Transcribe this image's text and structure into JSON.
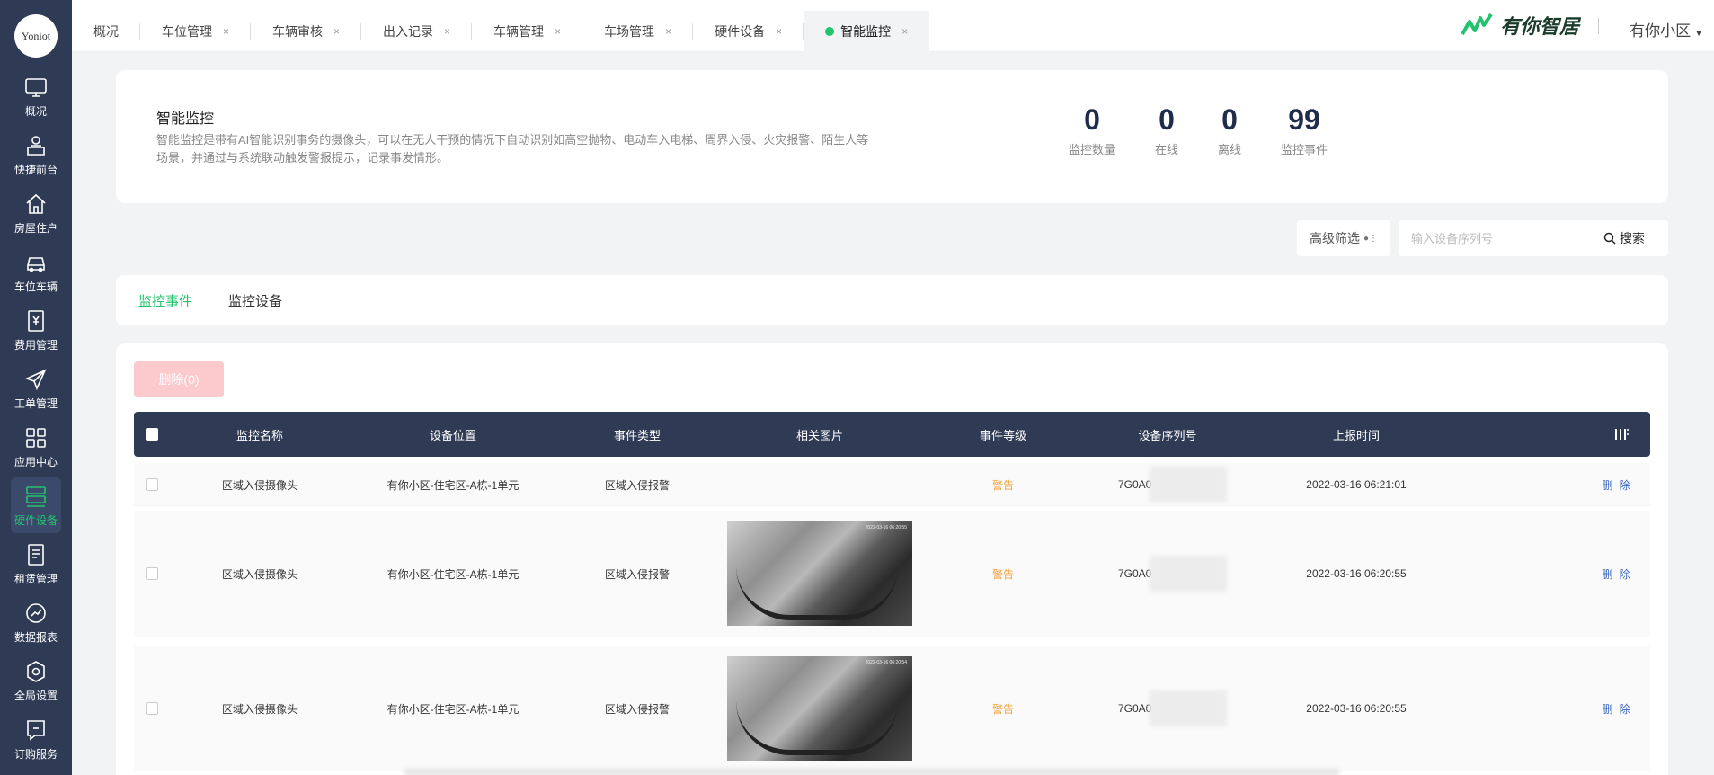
{
  "logo": {
    "text": "Yoniot"
  },
  "sidebar": {
    "items": [
      {
        "label": "概况",
        "icon": "monitor-icon"
      },
      {
        "label": "快捷前台",
        "icon": "desk-icon"
      },
      {
        "label": "房屋住户",
        "icon": "house-icon"
      },
      {
        "label": "车位车辆",
        "icon": "car-icon"
      },
      {
        "label": "费用管理",
        "icon": "fee-icon"
      },
      {
        "label": "工单管理",
        "icon": "send-icon"
      },
      {
        "label": "应用中心",
        "icon": "grid-icon"
      },
      {
        "label": "硬件设备",
        "icon": "server-icon",
        "active": true
      },
      {
        "label": "租赁管理",
        "icon": "document-icon"
      },
      {
        "label": "数据报表",
        "icon": "chart-icon"
      },
      {
        "label": "全局设置",
        "icon": "settings-icon"
      },
      {
        "label": "订购服务",
        "icon": "order-icon"
      }
    ]
  },
  "tabs": [
    {
      "label": "概况",
      "closable": false
    },
    {
      "label": "车位管理",
      "closable": true
    },
    {
      "label": "车辆审核",
      "closable": true
    },
    {
      "label": "出入记录",
      "closable": true
    },
    {
      "label": "车辆管理",
      "closable": true
    },
    {
      "label": "车场管理",
      "closable": true
    },
    {
      "label": "硬件设备",
      "closable": true
    },
    {
      "label": "智能监控",
      "closable": true,
      "active": true
    }
  ],
  "tab_close_glyph": "×",
  "brand": {
    "name": "有你智居"
  },
  "community": {
    "name": "有你小区"
  },
  "info": {
    "title": "智能监控",
    "description": "智能监控是带有AI智能识别事务的摄像头，可以在无人干预的情况下自动识别如高空抛物、电动车入电梯、周界入侵、火灾报警、陌生人等场景，并通过与系统联动触发警报提示，记录事发情形。",
    "stats": [
      {
        "value": "0",
        "label": "监控数量"
      },
      {
        "value": "0",
        "label": "在线"
      },
      {
        "value": "0",
        "label": "离线"
      },
      {
        "value": "99",
        "label": "监控事件"
      }
    ]
  },
  "filter": {
    "label": "高级筛选"
  },
  "search": {
    "placeholder": "输入设备序列号",
    "value": "",
    "button": "搜索"
  },
  "subtabs": [
    {
      "label": "监控事件",
      "active": true
    },
    {
      "label": "监控设备",
      "active": false
    }
  ],
  "table": {
    "delete_button": "删除(0)",
    "headers": [
      "监控名称",
      "设备位置",
      "事件类型",
      "相关图片",
      "事件等级",
      "设备序列号",
      "上报时间"
    ],
    "rows": [
      {
        "name": "区域入侵摄像头",
        "location": "有你小区-住宅区-A栋-1单元",
        "type": "区域入侵报警",
        "has_image": false,
        "level": "警告",
        "serial": "7G0A0",
        "time": "2022-03-16 06:21:01",
        "action": "删 除"
      },
      {
        "name": "区域入侵摄像头",
        "location": "有你小区-住宅区-A栋-1单元",
        "type": "区域入侵报警",
        "has_image": true,
        "image_timestamp": "2022-03-16 06:20:55",
        "level": "警告",
        "serial": "7G0A0",
        "time": "2022-03-16 06:20:55",
        "action": "删 除"
      },
      {
        "name": "区域入侵摄像头",
        "location": "有你小区-住宅区-A栋-1单元",
        "type": "区域入侵报警",
        "has_image": true,
        "image_timestamp": "2022-03-16 06:20:54",
        "level": "警告",
        "serial": "7G0A0",
        "time": "2022-03-16 06:20:55",
        "action": "删 除"
      }
    ]
  },
  "colors": {
    "accent": "#23c26d",
    "sidebar": "#2f3a55",
    "warning": "#f5a33a",
    "link": "#3b66c4"
  }
}
